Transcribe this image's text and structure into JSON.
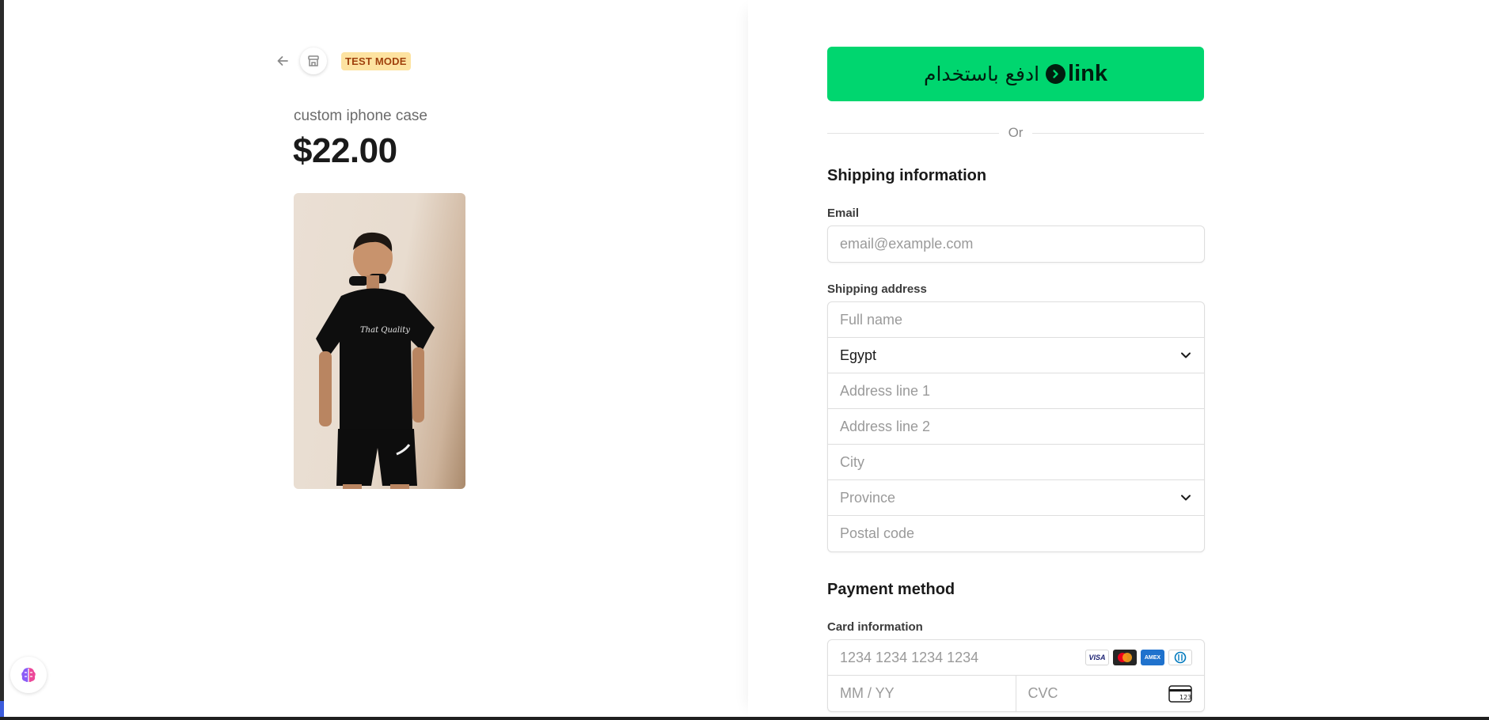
{
  "product": {
    "test_badge": "TEST MODE",
    "name": "custom iphone case",
    "price": "$22.00",
    "image_alt": "product photo"
  },
  "link_button": {
    "arabic_label": "ادفع باستخدام",
    "logo_text": "link"
  },
  "divider": {
    "or_label": "Or"
  },
  "shipping": {
    "title": "Shipping information",
    "email_label": "Email",
    "email_placeholder": "email@example.com",
    "address_label": "Shipping address",
    "full_name_placeholder": "Full name",
    "country_value": "Egypt",
    "address_line1_placeholder": "Address line 1",
    "address_line2_placeholder": "Address line 2",
    "city_placeholder": "City",
    "province_placeholder": "Province",
    "postal_code_placeholder": "Postal code"
  },
  "payment": {
    "title": "Payment method",
    "card_label": "Card information",
    "card_number_placeholder": "1234 1234 1234 1234",
    "expiry_placeholder": "MM / YY",
    "cvc_placeholder": "CVC",
    "brands": [
      "VISA",
      "mastercard",
      "AMEX",
      "diners"
    ]
  },
  "colors": {
    "link_green": "#00d66f",
    "test_badge_bg": "#fde3a1",
    "test_badge_text": "#a0410d"
  }
}
